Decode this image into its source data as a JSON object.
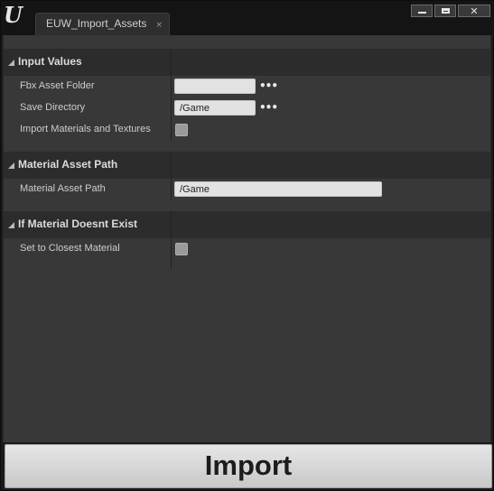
{
  "window": {
    "tab_title": "EUW_Import_Assets",
    "tab_close": "×",
    "controls": {
      "minimize": "minimize",
      "maximize": "maximize",
      "close": "close"
    }
  },
  "categories": [
    {
      "label": "Input Values",
      "rows": [
        {
          "label": "Fbx Asset Folder",
          "type": "path",
          "value": ""
        },
        {
          "label": "Save Directory",
          "type": "path",
          "value": "/Game"
        },
        {
          "label": "Import Materials and Textures",
          "type": "checkbox",
          "checked": false
        }
      ]
    },
    {
      "label": "Material Asset Path",
      "rows": [
        {
          "label": "Material Asset Path",
          "type": "text",
          "value": "/Game"
        }
      ]
    },
    {
      "label": "If Material Doesnt Exist",
      "rows": [
        {
          "label": "Set to Closest Material",
          "type": "checkbox",
          "checked": false
        }
      ]
    }
  ],
  "browse_glyph": "•••",
  "import_button": {
    "label": "Import"
  },
  "colors": {
    "panel": "#383838",
    "category_header": "#2c2c2c",
    "input_bg": "#e2e2e2",
    "titlebar": "#141414"
  }
}
